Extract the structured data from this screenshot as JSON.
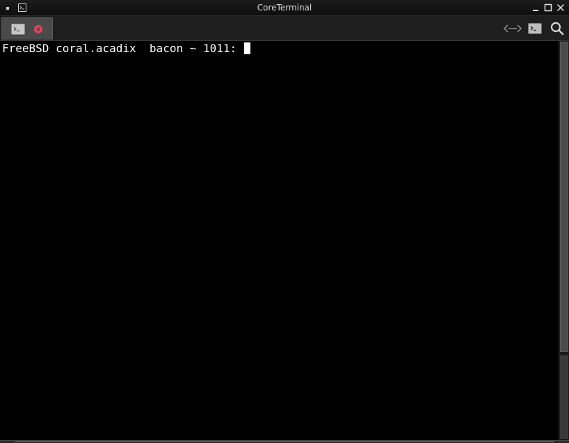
{
  "window": {
    "title": "CoreTerminal"
  },
  "titlebar_icons": {
    "menu": "window-menu-icon",
    "app": "terminal-app-icon",
    "minimize": "minimize-icon",
    "maximize": "maximize-icon",
    "close": "close-icon"
  },
  "tabs": [
    {
      "icon": "terminal-icon",
      "close_icon": "tab-close-icon",
      "active": true
    }
  ],
  "toolbar": {
    "split_icon": "split-view-icon",
    "new_terminal_icon": "terminal-icon",
    "search_icon": "search-icon"
  },
  "terminal": {
    "prompt": "FreeBSD coral.acadix  bacon ~ 1011: "
  },
  "colors": {
    "background": "#000000",
    "text": "#ffffff",
    "tab_close": "#e0455b",
    "chrome": "#1e1e1e"
  }
}
